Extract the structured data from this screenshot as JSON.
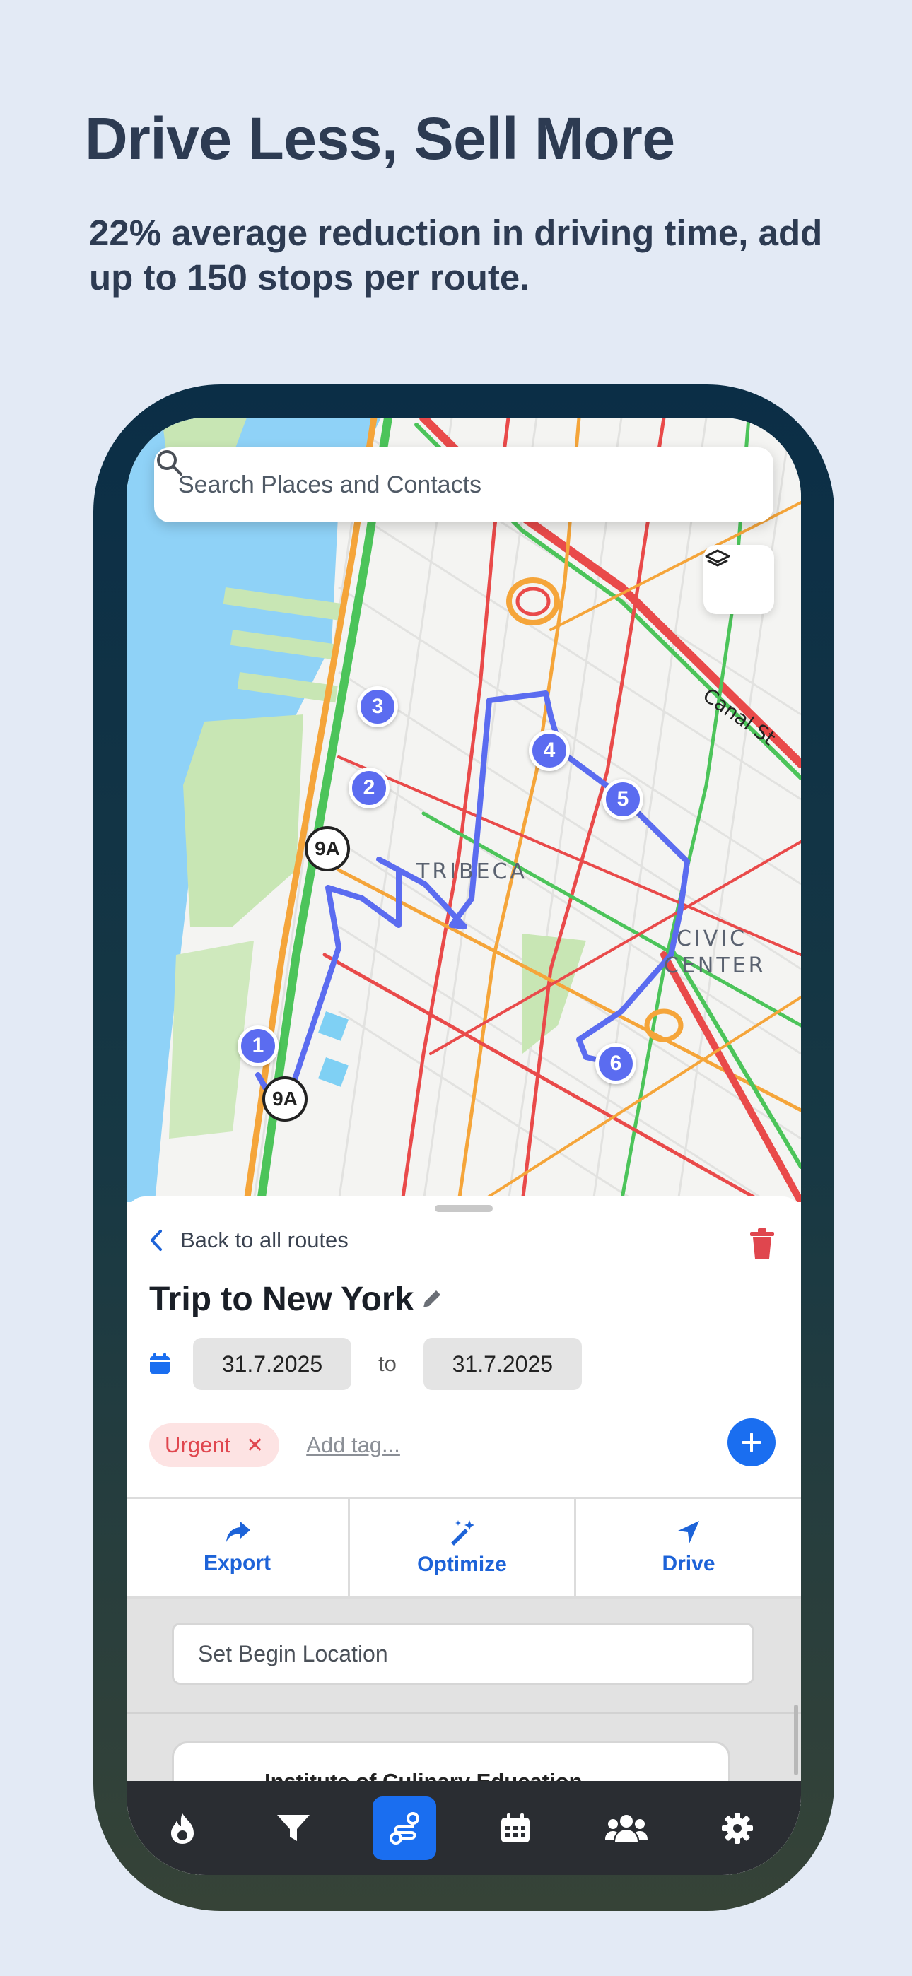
{
  "promo": {
    "headline": "Drive Less, Sell More",
    "subline": "22% average reduction in driving time, add up to 150 stops per route."
  },
  "search": {
    "placeholder": "Search Places and Contacts"
  },
  "map": {
    "labels": {
      "tribeca": "TRIBECA",
      "civic_center_1": "CIVIC",
      "civic_center_2": "CENTER",
      "canal_st": "Canal St"
    },
    "highways": [
      "9A",
      "9A"
    ],
    "stops": [
      "1",
      "2",
      "3",
      "4",
      "5",
      "6"
    ],
    "colors": {
      "water": "#8fd2f7",
      "park": "#c8e6b4",
      "route": "#5b6cf0",
      "traffic_green": "#4cc45a",
      "traffic_orange": "#f5a53a",
      "traffic_red": "#e94a4a"
    }
  },
  "sheet": {
    "back_label": "Back to all routes",
    "trip_title": "Trip to New York",
    "date_from": "31.7.2025",
    "date_to_word": "to",
    "date_to": "31.7.2025",
    "tags": [
      {
        "label": "Urgent",
        "remove": "✕"
      }
    ],
    "add_tag": "Add tag...",
    "actions": [
      {
        "label": "Export",
        "icon": "share-arrow-icon"
      },
      {
        "label": "Optimize",
        "icon": "magic-wand-icon"
      },
      {
        "label": "Drive",
        "icon": "navigation-arrow-icon"
      }
    ],
    "begin_location": "Set Begin Location",
    "stops_list": [
      {
        "name": "Institute of Culinary Education"
      }
    ],
    "accent": "#1a6ef0",
    "danger": "#e0464e"
  },
  "navbar": {
    "items": [
      "flame-icon",
      "filter-icon",
      "route-icon",
      "calendar-icon",
      "team-icon",
      "gear-icon"
    ],
    "active": "route-icon"
  }
}
